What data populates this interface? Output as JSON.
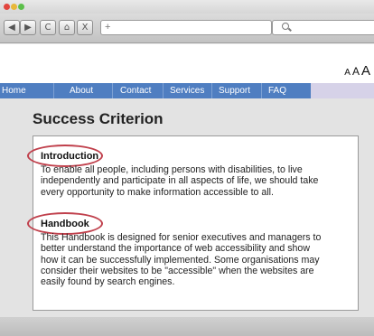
{
  "browser": {
    "controls": [
      "red",
      "yellow",
      "green"
    ],
    "toolbar_icons": [
      {
        "name": "back-icon",
        "glyph": "◀"
      },
      {
        "name": "forward-icon",
        "glyph": "▶"
      },
      {
        "name": "reload-icon",
        "glyph": "C"
      },
      {
        "name": "home-icon",
        "glyph": "⌂"
      },
      {
        "name": "stop-icon",
        "glyph": "X"
      }
    ],
    "new_tab_label": "+",
    "url_value": "",
    "search_value": ""
  },
  "font_size_controls": [
    "A",
    "A",
    "A"
  ],
  "nav": {
    "items": [
      "Home",
      "About",
      "Contact",
      "Services",
      "Support",
      "FAQ"
    ]
  },
  "page": {
    "heading": "Success Criterion",
    "sections": [
      {
        "title": "Introduction",
        "lines": [
          "To enable all people, including persons with disabilities, to live",
          "independently and participate in all aspects of life, we should take",
          "every opportunity to make information accessible to all."
        ]
      },
      {
        "title": "Handbook",
        "lines": [
          "This Handbook is designed for senior executives and managers to",
          "better understand the importance of web accessibility and show",
          "how it can be successfully implemented. Some organisations may",
          "consider their websites to be \"accessible\" when the websites are",
          "easily found by search engines."
        ]
      }
    ]
  },
  "colors": {
    "nav_bar": "#4f7ec1",
    "highlight_ring": "#c0404c",
    "content_bg": "#e3e3e3"
  }
}
